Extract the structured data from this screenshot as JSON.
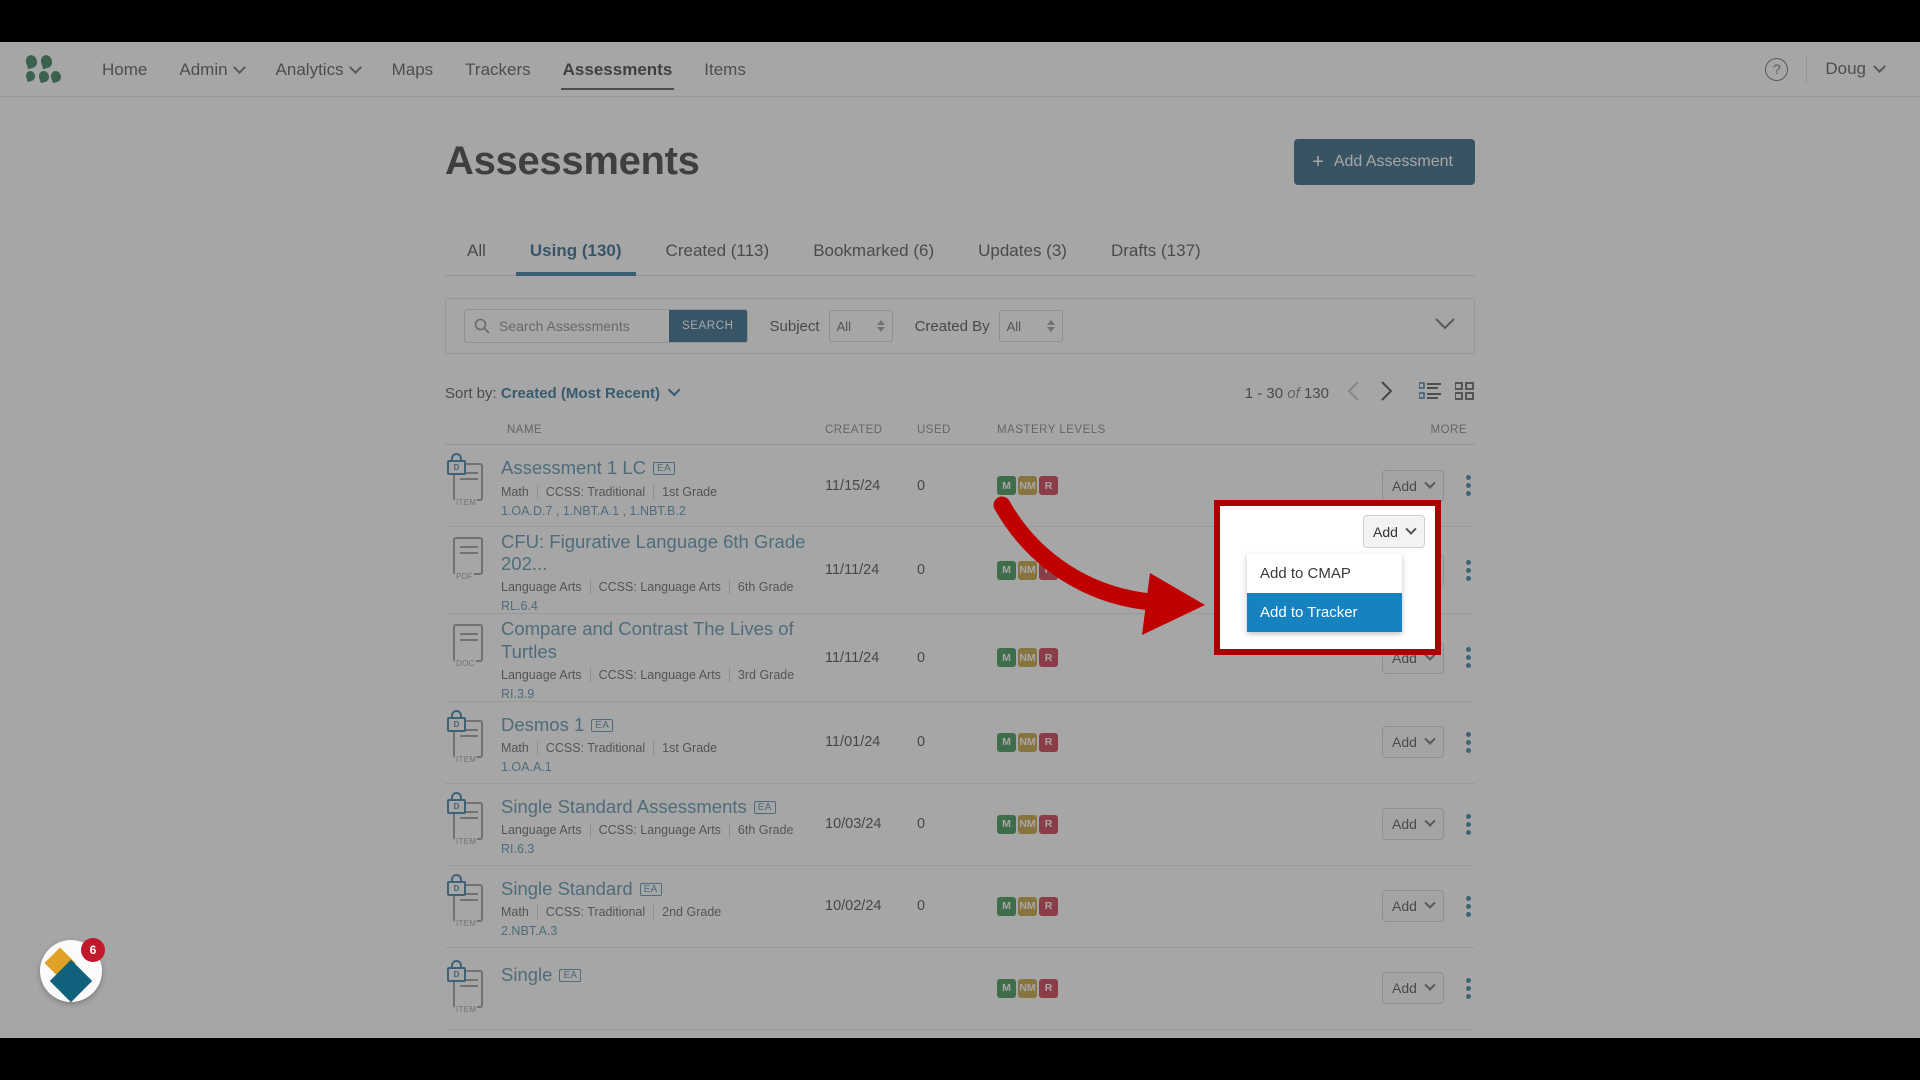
{
  "topnav": {
    "logo": "three-dots-logo",
    "items": [
      {
        "label": "Home",
        "has_caret": false,
        "active": false
      },
      {
        "label": "Admin",
        "has_caret": true,
        "active": false
      },
      {
        "label": "Analytics",
        "has_caret": true,
        "active": false
      },
      {
        "label": "Maps",
        "has_caret": false,
        "active": false
      },
      {
        "label": "Trackers",
        "has_caret": false,
        "active": false
      },
      {
        "label": "Assessments",
        "has_caret": false,
        "active": true
      },
      {
        "label": "Items",
        "has_caret": false,
        "active": false
      }
    ],
    "help_label": "?",
    "user_label": "Doug"
  },
  "page": {
    "title": "Assessments",
    "add_assessment_label": "Add Assessment"
  },
  "tabs": [
    {
      "label": "All",
      "active": false
    },
    {
      "label": "Using (130)",
      "active": true
    },
    {
      "label": "Created (113)",
      "active": false
    },
    {
      "label": "Bookmarked (6)",
      "active": false
    },
    {
      "label": "Updates (3)",
      "active": false
    },
    {
      "label": "Drafts (137)",
      "active": false
    }
  ],
  "filters": {
    "search_placeholder": "Search Assessments",
    "search_value": "",
    "search_button": "SEARCH",
    "subject_label": "Subject",
    "subject_value": "All",
    "created_by_label": "Created By",
    "created_by_value": "All"
  },
  "sort": {
    "prefix": "Sort by:",
    "value": "Created (Most Recent)"
  },
  "pagination": {
    "range": "1 - 30",
    "of": "of",
    "total": "130",
    "prev": "‹",
    "next": "›"
  },
  "table": {
    "headers": {
      "name": "NAME",
      "created": "CREATED",
      "used": "USED",
      "mastery": "MASTERY LEVELS",
      "more": "MORE"
    },
    "add_label": "Add",
    "rows": [
      {
        "title": "Assessment 1 LC",
        "badge": "EA",
        "locked": true,
        "doc_kind": "ITEM",
        "subject": "Math",
        "framework": "CCSS: Traditional",
        "grade": "1st Grade",
        "standards": "1.OA.D.7 , 1.NBT.A.1 , 1.NBT.B.2",
        "created": "11/15/24",
        "used": "0",
        "mastery": [
          "M",
          "NM",
          "R"
        ]
      },
      {
        "title": "CFU: Figurative Language 6th Grade 202...",
        "badge": "",
        "locked": false,
        "doc_kind": "PDF",
        "subject": "Language Arts",
        "framework": "CCSS: Language Arts",
        "grade": "6th Grade",
        "standards": "RL.6.4",
        "created": "11/11/24",
        "used": "0",
        "mastery": [
          "M",
          "NM",
          "R"
        ]
      },
      {
        "title": "Compare and Contrast The Lives of Turtles",
        "badge": "",
        "locked": false,
        "doc_kind": "DOC",
        "subject": "Language Arts",
        "framework": "CCSS: Language Arts",
        "grade": "3rd Grade",
        "standards": "RI.3.9",
        "created": "11/11/24",
        "used": "0",
        "mastery": [
          "M",
          "NM",
          "R"
        ]
      },
      {
        "title": "Desmos 1",
        "badge": "EA",
        "locked": true,
        "doc_kind": "ITEM",
        "subject": "Math",
        "framework": "CCSS: Traditional",
        "grade": "1st Grade",
        "standards": "1.OA.A.1",
        "created": "11/01/24",
        "used": "0",
        "mastery": [
          "M",
          "NM",
          "R"
        ]
      },
      {
        "title": "Single Standard Assessments",
        "badge": "EA",
        "locked": true,
        "doc_kind": "ITEM",
        "subject": "Language Arts",
        "framework": "CCSS: Language Arts",
        "grade": "6th Grade",
        "standards": "RI.6.3",
        "created": "10/03/24",
        "used": "0",
        "mastery": [
          "M",
          "NM",
          "R"
        ]
      },
      {
        "title": "Single Standard",
        "badge": "EA",
        "locked": true,
        "doc_kind": "ITEM",
        "subject": "Math",
        "framework": "CCSS: Traditional",
        "grade": "2nd Grade",
        "standards": "2.NBT.A.3",
        "created": "10/02/24",
        "used": "0",
        "mastery": [
          "M",
          "NM",
          "R"
        ]
      },
      {
        "title": "Single",
        "badge": "EA",
        "locked": true,
        "doc_kind": "ITEM",
        "subject": "",
        "framework": "",
        "grade": "",
        "standards": "",
        "created": "",
        "used": "",
        "mastery": [
          "M",
          "NM",
          "R"
        ]
      }
    ]
  },
  "highlight": {
    "add_button_label": "Add",
    "menu": [
      {
        "label": "Add to CMAP",
        "selected": false
      },
      {
        "label": "Add to Tracker",
        "selected": true
      }
    ],
    "outline_color": "#aa0000",
    "selected_color": "#1683c0"
  },
  "fab": {
    "badge_count": "6"
  }
}
